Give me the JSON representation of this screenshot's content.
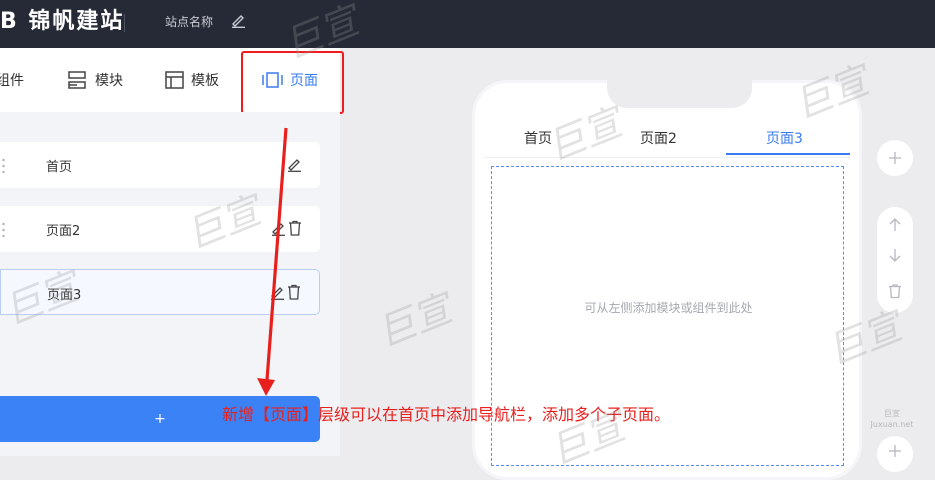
{
  "header": {
    "logo_text": "B 锦帆建站",
    "site_name": "站点名称"
  },
  "tabs": [
    {
      "label": "组件",
      "icon": "components-icon"
    },
    {
      "label": "模块",
      "icon": "module-icon"
    },
    {
      "label": "模板",
      "icon": "template-icon"
    },
    {
      "label": "页面",
      "icon": "page-icon",
      "active": true
    }
  ],
  "pages": [
    {
      "label": "首页"
    },
    {
      "label": "页面2"
    },
    {
      "label": "页面3",
      "selected": true
    }
  ],
  "add_page_label": "+",
  "preview": {
    "nav_tabs": [
      "首页",
      "页面2",
      "页面3"
    ],
    "active_tab": "页面3",
    "empty_hint": "可从左侧添加模块或组件到此处"
  },
  "annotation": {
    "text": "新增【页面】层级可以在首页中添加导航栏，添加多个子页面。"
  },
  "watermark": {
    "text": "巨宣",
    "small_brand": "巨宣",
    "small_url": "Juxuan.net"
  },
  "colors": {
    "accent": "#3a7cf0",
    "topbar": "#252a36",
    "annotation": "#e8201d",
    "add_button": "#3b82f6"
  }
}
